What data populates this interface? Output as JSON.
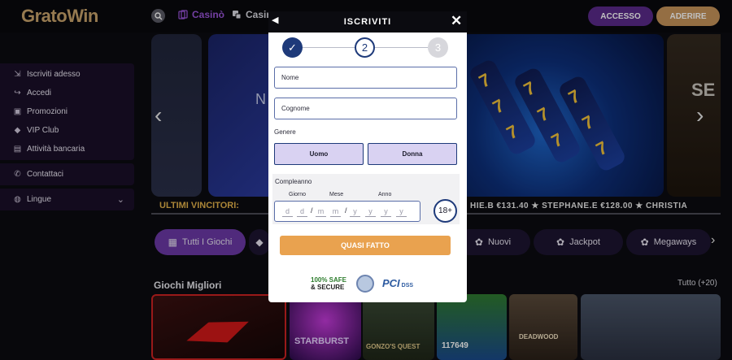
{
  "header": {
    "logo_part1": "Grato",
    "logo_part2": "Win",
    "nav": [
      {
        "label": "Casinò",
        "icon": "cards-icon"
      },
      {
        "label": "Casin",
        "icon": "dice-icon"
      }
    ],
    "login_label": "ACCESSO",
    "signup_label": "ADERIRE"
  },
  "sidebar": {
    "items": [
      {
        "label": "Iscriviti adesso",
        "icon": "login-icon"
      },
      {
        "label": "Accedi",
        "icon": "enter-icon"
      },
      {
        "label": "Promozioni",
        "icon": "gift-icon"
      },
      {
        "label": "VIP Club",
        "icon": "diamond-icon"
      },
      {
        "label": "Attività bancaria",
        "icon": "wallet-icon"
      }
    ],
    "contact_label": "Contattaci",
    "language_label": "Lingue"
  },
  "banner": {
    "left_slide_text": "N",
    "right_slide_text": "SE"
  },
  "ticker": {
    "title": "ULTIMI VINCITORI:",
    "entries": "HIE.B €131.40   ★ STEPHANE.E €128.00   ★ CHRISTIA"
  },
  "categories": [
    {
      "label": "Tutti I Giochi",
      "icon": "grid-icon",
      "active": true
    },
    {
      "label": "",
      "icon": "diamond-icon",
      "active": false
    },
    {
      "label": "Nuovi",
      "icon": "gear-icon",
      "active": false
    },
    {
      "label": "Jackpot",
      "icon": "gear-icon",
      "active": false
    },
    {
      "label": "Megaways",
      "icon": "gear-icon",
      "active": false
    }
  ],
  "games": {
    "title": "Giochi Migliori",
    "all_label": "Tutto (+20)",
    "tiles": [
      "",
      "STARBURST",
      "GONZO'S QUEST",
      "117649",
      "DEADWOOD",
      ""
    ]
  },
  "modal": {
    "title": "ISCRIVITI",
    "steps": [
      "✓",
      "2",
      "3"
    ],
    "first_name_placeholder": "Nome",
    "last_name_placeholder": "Cognome",
    "gender_label": "Genere",
    "male_label": "Uomo",
    "female_label": "Donna",
    "birthday_label": "Compleanno",
    "day_label": "Giorno",
    "month_label": "Mese",
    "year_label": "Anno",
    "day_chars": [
      "d",
      "d"
    ],
    "month_chars": [
      "m",
      "m"
    ],
    "year_chars": [
      "y",
      "y",
      "y",
      "y"
    ],
    "age_badge": "18+",
    "cta_label": "QUASI FATTO",
    "safe_line1": "100% SAFE",
    "safe_line2": "& SECURE",
    "pci_label": "PCI",
    "dss_label": "DSS"
  },
  "colors": {
    "accent_purple": "#6b38a6",
    "cta_orange": "#e9a24f",
    "step_blue": "#1e3a7a",
    "ticker_gold": "#e3b24a"
  }
}
